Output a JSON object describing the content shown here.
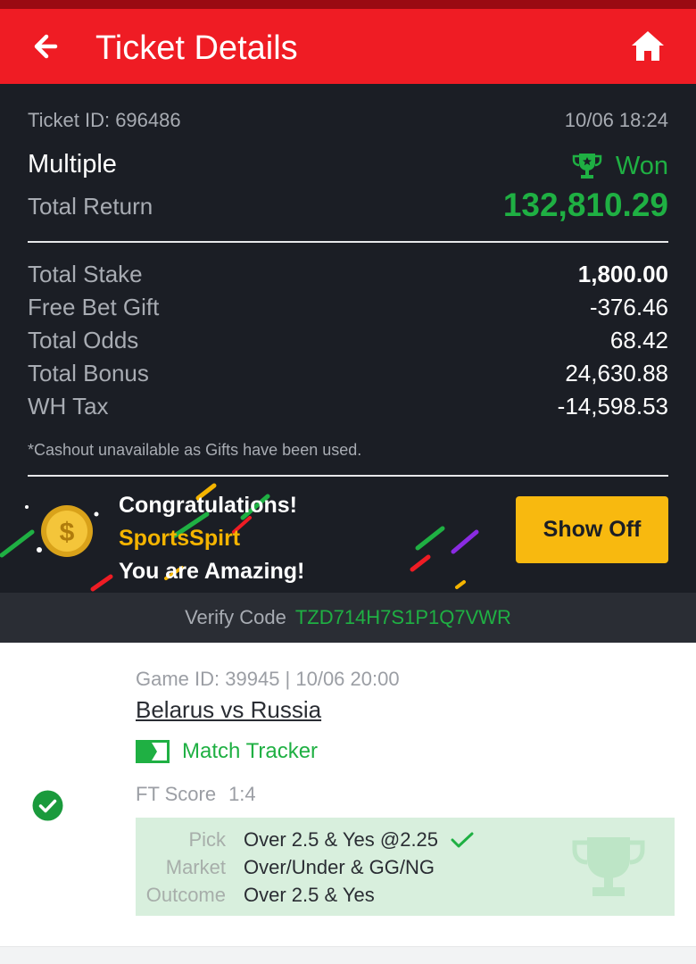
{
  "header": {
    "title": "Ticket Details"
  },
  "ticket": {
    "id_text": "Ticket ID: 696486",
    "datetime": "10/06 18:24",
    "type": "Multiple",
    "status": "Won",
    "total_return_label": "Total Return",
    "total_return_value": "132,810.29",
    "rows": [
      {
        "label": "Total Stake",
        "value": "1,800.00"
      },
      {
        "label": "Free Bet Gift",
        "value": "-376.46"
      },
      {
        "label": "Total Odds",
        "value": "68.42"
      },
      {
        "label": "Total Bonus",
        "value": "24,630.88"
      },
      {
        "label": "WH Tax",
        "value": "-14,598.53"
      }
    ],
    "note": "*Cashout unavailable as Gifts have been used."
  },
  "promo": {
    "line1": "Congratulations!",
    "line2": "SportsSpirt",
    "line3": "You are Amazing!",
    "button": "Show Off"
  },
  "verify": {
    "label": "Verify Code",
    "code": "TZD714H7S1P1Q7VWR"
  },
  "game": {
    "id_text": "Game ID: 39945 | 10/06 20:00",
    "teams": "Belarus vs Russia",
    "tracker": "Match Tracker",
    "ft_label": "FT Score",
    "ft_score": "1:4",
    "pick_label": "Pick",
    "pick_value": "Over 2.5 & Yes @2.25",
    "market_label": "Market",
    "market_value": "Over/Under & GG/NG",
    "outcome_label": "Outcome",
    "outcome_value": "Over 2.5 & Yes"
  },
  "colors": {
    "header": "#ef1c24",
    "dark_bg": "#1b1e25",
    "win_green": "#1fb043",
    "button_yellow": "#f8b90f"
  },
  "icons": [
    "arrow-left-icon",
    "home-icon",
    "trophy-icon",
    "coin-icon",
    "tracker-icon",
    "check-circle-icon",
    "checkmark-icon"
  ]
}
